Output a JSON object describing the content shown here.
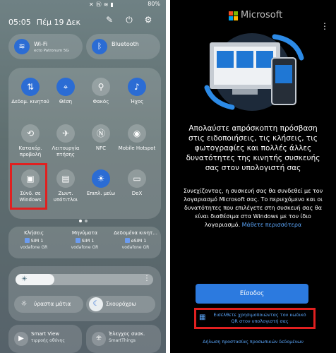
{
  "left": {
    "status": {
      "time": "05:05",
      "battery": "80%"
    },
    "header": {
      "time": "05:05",
      "date": "Πέμ 19 Δεκ"
    },
    "wifi": {
      "label": "Wi-Fi",
      "sub": "ecto Patronum 5G"
    },
    "bluetooth": {
      "label": "Bluetooth"
    },
    "tiles": [
      {
        "label": "Δεδομ. κινητού",
        "icon": "mobile-data-icon",
        "on": true
      },
      {
        "label": "Θέση",
        "icon": "location-icon",
        "on": true
      },
      {
        "label": "Φακός",
        "icon": "flashlight-icon",
        "on": false
      },
      {
        "label": "Ήχος",
        "icon": "sound-icon",
        "on": true
      },
      {
        "label": "Κατακόρ. προβολή",
        "icon": "rotation-lock-icon",
        "on": false
      },
      {
        "label": "Λειτουργία πτήσης",
        "icon": "airplane-icon",
        "on": false
      },
      {
        "label": "NFC",
        "icon": "nfc-icon",
        "on": false
      },
      {
        "label": "Mobile Hotspot",
        "icon": "hotspot-icon",
        "on": false
      },
      {
        "label": "Σύνδ. σε Windows",
        "icon": "link-to-windows-icon",
        "on": false
      },
      {
        "label": "Ζωντ. υπότιτλοι",
        "icon": "live-caption-icon",
        "on": false
      },
      {
        "label": "Επιπλ. μείω",
        "icon": "extra-dim-icon",
        "on": true
      },
      {
        "label": "DeX",
        "icon": "dex-icon",
        "on": false
      }
    ],
    "sim": [
      {
        "heading": "Κλήσεις",
        "sim": "SIM 1",
        "carrier": "vodafone GR"
      },
      {
        "heading": "Μηνύματα",
        "sim": "SIM 1",
        "carrier": "vodafone GR"
      },
      {
        "heading": "Δεδομένα κινητ...",
        "sim": "eSIM 1",
        "carrier": "vodafone GR"
      }
    ],
    "brightness": {
      "level": 0.28
    },
    "modes": {
      "eye": "ύραστα μάτια",
      "dark": "Σκουρόχρω"
    },
    "bottom": [
      {
        "title": "Smart View",
        "sub": "τιρροής οθόνης"
      },
      {
        "title": "Έλεγχος συσκ.",
        "sub": "SmartThings"
      }
    ]
  },
  "right": {
    "brand": "Microsoft",
    "logo_colors": [
      "#f25022",
      "#7fba00",
      "#00a4ef",
      "#ffb900"
    ],
    "headline": "Απολαύστε απρόσκοπτη πρόσβαση στις ειδοποιήσεις, τις κλήσεις, τις φωτογραφίες και πολλές άλλες δυνατότητες της κινητής συσκευής σας στον υπολογιστή σας",
    "body": "Συνεχίζοντας, η συσκευή σας θα συνδεθεί με τον λογαριασμό Microsoft σας. Το περιεχόμενο και οι δυνατότητες που επιλέγετε στη συσκευή σας θα είναι διαθέσιμα στα Windows με τον ίδιο λογαριασμό.",
    "learn_more": "Μάθετε περισσότερα",
    "signin": "Είσοδος",
    "qr_text": "Εισέλθετε χρησιμοποιώντας τον κωδικό QR στον υπολογιστή σας",
    "privacy": "Δήλωση προστασίας προσωπικών δεδομένων"
  }
}
